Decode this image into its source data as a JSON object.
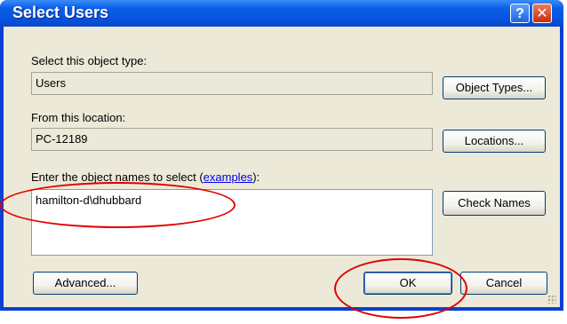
{
  "window": {
    "title": "Select Users",
    "help_glyph": "?",
    "close_glyph": "✕"
  },
  "object_type": {
    "label": "Select this object type:",
    "value": "Users",
    "button": "Object Types..."
  },
  "location": {
    "label": "From this location:",
    "value": "PC-12189",
    "button": "Locations..."
  },
  "names": {
    "label_before": "Enter the object names to select (",
    "link": "examples",
    "label_after": "):",
    "value": "hamilton-d\\dhubbard",
    "check_button": "Check Names"
  },
  "footer": {
    "advanced_button": "Advanced...",
    "ok_button": "OK",
    "cancel_button": "Cancel"
  },
  "colors": {
    "annotation": "#e00000",
    "titlebar": "#0654e0",
    "dialog_bg": "#ece9d8"
  }
}
